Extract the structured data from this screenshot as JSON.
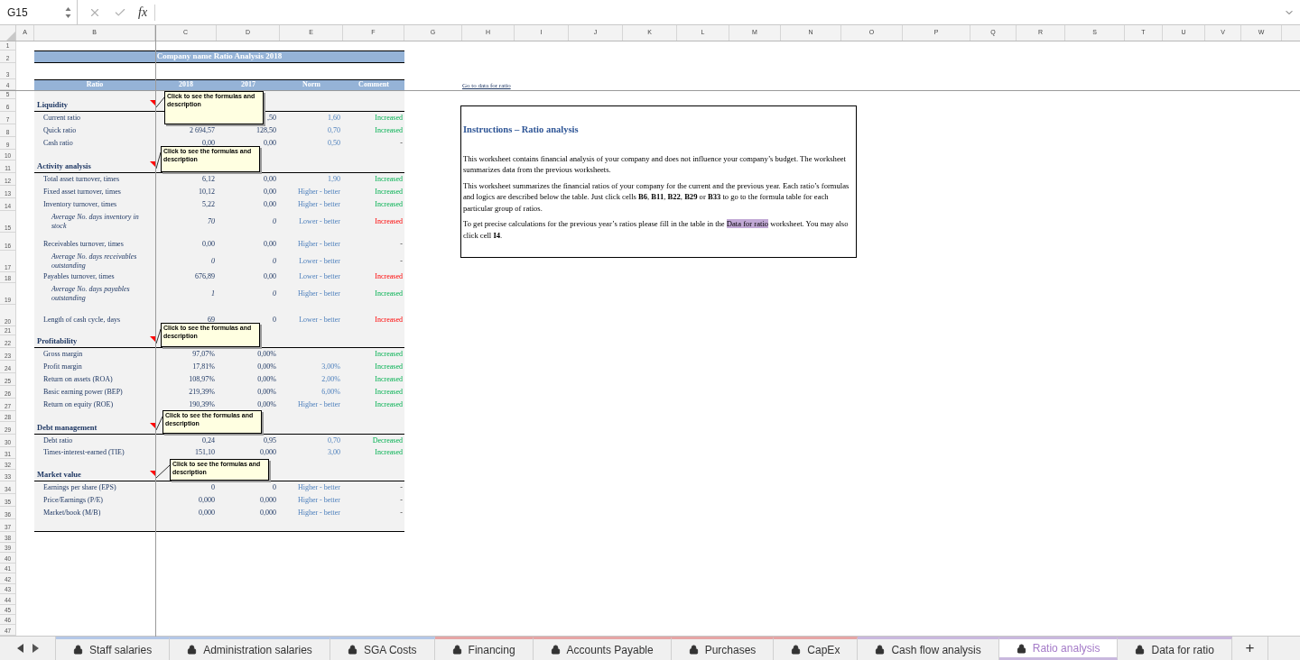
{
  "formula_bar": {
    "cell_reference": "G15",
    "function_label": "fx"
  },
  "sheet": {
    "column_headers": [
      "A",
      "B",
      "C",
      "D",
      "E",
      "F",
      "G",
      "H",
      "I",
      "J",
      "K",
      "L",
      "M",
      "N",
      "O",
      "P",
      "Q",
      "R",
      "S",
      "T",
      "U",
      "V",
      "W"
    ],
    "row_headers": [
      "1",
      "2",
      "3",
      "4",
      "5",
      "6",
      "7",
      "8",
      "9",
      "10",
      "11",
      "12",
      "13",
      "14",
      "15",
      "16",
      "17",
      "18",
      "19",
      "20",
      "21",
      "22",
      "23",
      "24",
      "25",
      "26",
      "27",
      "28",
      "29",
      "30",
      "31",
      "32",
      "33",
      "34",
      "35",
      "36",
      "37",
      "38",
      "39",
      "40",
      "41",
      "42",
      "43",
      "44",
      "45",
      "46",
      "47"
    ],
    "title": "Company name Ratio Analysis 2018",
    "table": {
      "columns": [
        "Ratio",
        "2018",
        "2017",
        "Norm",
        "Comment"
      ],
      "sections": [
        {
          "heading": "Liquidity",
          "note": "Click to see the formulas and description",
          "rows": [
            {
              "kind": "ratio",
              "label": "Current ratio",
              "y2017": ",50",
              "norm": "1,60",
              "comment": "Increased",
              "favorable": true
            },
            {
              "kind": "ratio",
              "label": "Quick ratio",
              "y2018": "2 694,57",
              "y2017": "128,50",
              "norm": "0,70",
              "comment": "Increased",
              "favorable": true
            },
            {
              "kind": "ratio",
              "label": "Cash ratio",
              "y2018": "0,00",
              "y2017": "0,00",
              "norm": "0,50",
              "comment": "-"
            }
          ]
        },
        {
          "heading": "Activity analysis",
          "note": "Click to see the formulas and description",
          "rows": [
            {
              "kind": "ratio",
              "label": "Total asset turnover, times",
              "y2018": "6,12",
              "y2017": "0,00",
              "norm": "1,90",
              "comment": "Increased",
              "favorable": true
            },
            {
              "kind": "ratio",
              "label": "Fixed asset turnover, times",
              "y2018": "10,12",
              "y2017": "0,00",
              "norm": "Higher - better",
              "comment": "Increased",
              "favorable": true
            },
            {
              "kind": "ratio",
              "label": "Inventory turnover, times",
              "y2018": "5,22",
              "y2017": "0,00",
              "norm": "Higher - better",
              "comment": "Increased",
              "favorable": true
            },
            {
              "kind": "sub",
              "label": "Average No. days inventory in stock",
              "y2018": "70",
              "y2017": "0",
              "norm": "Lower - better",
              "comment": "Increased",
              "favorable": false
            },
            {
              "kind": "ratio",
              "label": "Receivables turnover, times",
              "y2018": "0,00",
              "y2017": "0,00",
              "norm": "Higher - better",
              "comment": "-"
            },
            {
              "kind": "sub",
              "label": "Average No. days receivables outstanding",
              "y2018": "0",
              "y2017": "0",
              "norm": "Lower - better",
              "comment": "-"
            },
            {
              "kind": "ratio",
              "label": "Payables turnover, times",
              "y2018": "676,89",
              "y2017": "0,00",
              "norm": "Lower - better",
              "comment": "Increased",
              "favorable": false
            },
            {
              "kind": "sub",
              "label": "Average No. days payables outstanding",
              "y2018": "1",
              "y2017": "0",
              "norm": "Higher - better",
              "comment": "Increased",
              "favorable": true
            },
            {
              "kind": "ratio",
              "label": "Length of cash cycle, days",
              "y2018": "69",
              "y2017": "0",
              "norm": "Lower - better",
              "comment": "Increased",
              "favorable": false
            }
          ]
        },
        {
          "heading": "Profitability",
          "note": "Click to see the formulas and description",
          "rows": [
            {
              "kind": "ratio",
              "label": "Gross margin",
              "y2018": "97,07%",
              "y2017": "0,00%",
              "comment": "Increased",
              "favorable": true
            },
            {
              "kind": "ratio",
              "label": "Profit margin",
              "y2018": "17,81%",
              "y2017": "0,00%",
              "norm": "3,00%",
              "comment": "Increased",
              "favorable": true
            },
            {
              "kind": "ratio",
              "label": "Return on assets (ROA)",
              "y2018": "108,97%",
              "y2017": "0,00%",
              "norm": "2,00%",
              "comment": "Increased",
              "favorable": true
            },
            {
              "kind": "ratio",
              "label": "Basic earning power (BEP)",
              "y2018": "219,39%",
              "y2017": "0,00%",
              "norm": "6,00%",
              "comment": "Increased",
              "favorable": true
            },
            {
              "kind": "ratio",
              "label": "Return on equity (ROE)",
              "y2018": "190,39%",
              "y2017": "0,00%",
              "norm": "Higher - better",
              "comment": "Increased",
              "favorable": true
            }
          ]
        },
        {
          "heading": "Debt management",
          "note": "Click to see the formulas and description",
          "rows": [
            {
              "kind": "ratio",
              "label": "Debt ratio",
              "y2018": "0,24",
              "y2017": "0,95",
              "norm": "0,70",
              "comment": "Decreased",
              "favorable": true
            },
            {
              "kind": "ratio",
              "label": "Times-interest-earned (TIE)",
              "y2018": "151,10",
              "y2017": "0,000",
              "norm": "3,00",
              "comment": "Increased",
              "favorable": true
            }
          ]
        },
        {
          "heading": "Market value",
          "note": "Click to see the formulas and description",
          "rows": [
            {
              "kind": "ratio",
              "label": "Earnings per share (EPS)",
              "y2018": "0",
              "y2017": "0",
              "norm": "Higher - better",
              "comment": "-"
            },
            {
              "kind": "ratio",
              "label": "Price/Earnings (P/E)",
              "y2018": "0,000",
              "y2017": "0,000",
              "norm": "Higher - better",
              "comment": "-"
            },
            {
              "kind": "ratio",
              "label": "Market/book (M/B)",
              "y2018": "0,000",
              "y2017": "0,000",
              "norm": "Higher - better",
              "comment": "-"
            }
          ]
        }
      ]
    },
    "link": "Go to data for ratio",
    "instructions": {
      "title": "Instructions – Ratio analysis",
      "paragraphs": [
        [
          {
            "text": "This worksheet contains financial analysis of your company and does not influence your company’s budget. The worksheet summarizes data from the previous worksheets.",
            "highlighted": false
          }
        ],
        [
          {
            "text": "This worksheet summarizes the financial ratios of your company for the current and the previous year. Each ratio’s formulas and logics are described below the table. Just click cells **B6**, **B11**, **B22**, **B29** or **B33** to go to the formula table for each particular group of ratios.",
            "highlighted": false
          }
        ],
        [
          {
            "text": "To get precise calculations for the previous year’s ratios please fill in the table in the ",
            "highlighted": false
          },
          {
            "text": "Data for ratio",
            "highlighted": true
          },
          {
            "text": " worksheet. You may also click cell **I4**.",
            "highlighted": false
          }
        ]
      ]
    }
  },
  "sheet_tabs": [
    {
      "label": "Staff salaries",
      "color": "#b4c7e7",
      "selected": false
    },
    {
      "label": "Administration salaries",
      "color": "#b4c7e7",
      "selected": false
    },
    {
      "label": "SGA Costs",
      "color": "#b4c7e7",
      "selected": false
    },
    {
      "label": "Financing",
      "color": "#e6a5a5",
      "selected": false
    },
    {
      "label": "Accounts Payable",
      "color": "#e6a5a5",
      "selected": false
    },
    {
      "label": "Purchases",
      "color": "#e6a5a5",
      "selected": false
    },
    {
      "label": "CapEx",
      "color": "#e6a5a5",
      "selected": false
    },
    {
      "label": "Cash flow analysis",
      "color": "#c9b8de",
      "selected": false
    },
    {
      "label": "Ratio analysis",
      "color": "#c9b8de",
      "selected": true
    },
    {
      "label": "Data for ratio",
      "color": "#c9b8de",
      "selected": false
    }
  ],
  "add_sheet": "+"
}
